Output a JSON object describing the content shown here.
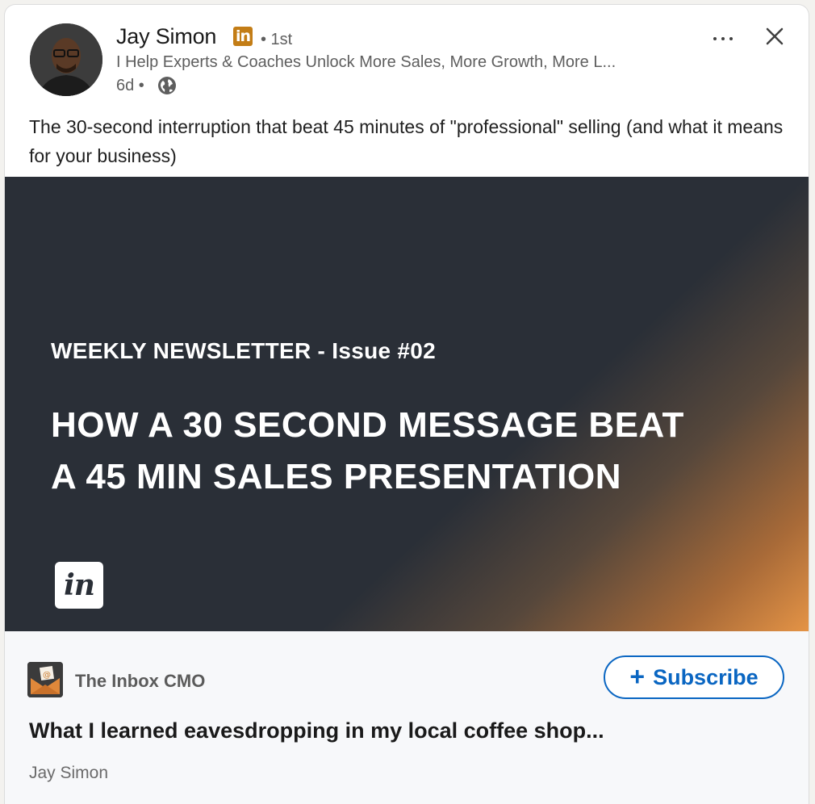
{
  "post": {
    "author_name": "Jay Simon",
    "badge_icon": "linkedin-premium-icon",
    "badge_text": "in",
    "connection": "• 1st",
    "headline": "I Help Experts & Coaches Unlock More Sales, More Growth, More L...",
    "time": "6d •",
    "visibility_icon": "globe-icon",
    "text": "The 30-second interruption that beat 45 minutes of \"professional\" selling (and what it means for your business)"
  },
  "actions": {
    "more_icon": "more-horizontal-icon",
    "close_icon": "close-icon"
  },
  "banner": {
    "kicker": "WEEKLY NEWSLETTER - Issue #02",
    "title_line1": "HOW A 30 SECOND MESSAGE BEAT",
    "title_line2": "A 45 MIN SALES PRESENTATION",
    "logo_text": "in"
  },
  "newsletter": {
    "thumbnail_icon": "envelope-icon",
    "name": "The Inbox CMO",
    "subscribe_label": "Subscribe",
    "subscribe_icon": "plus-icon",
    "article_title": "What I learned eavesdropping in my local coffee shop...",
    "article_author": "Jay Simon"
  },
  "colors": {
    "accent": "#0a66c2",
    "premium_badge": "#c37d16",
    "banner_dark": "#2a2f37",
    "banner_orange": "#e59446"
  }
}
